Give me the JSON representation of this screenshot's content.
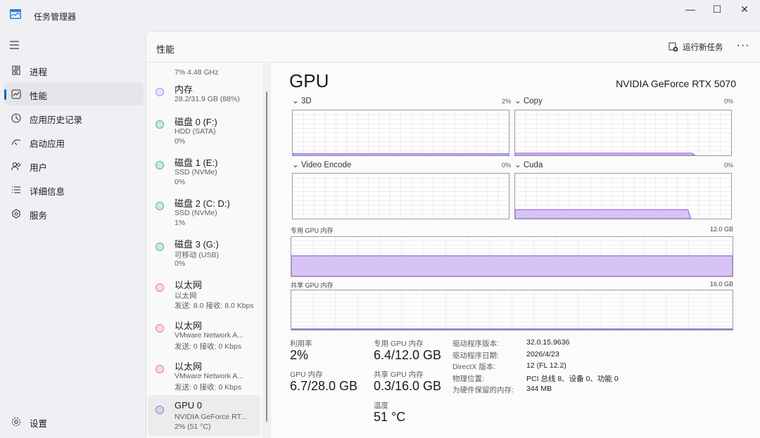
{
  "window": {
    "title": "任务管理器",
    "minimize": "—",
    "maximize": "☐",
    "close": "✕"
  },
  "nav": {
    "items": [
      {
        "label": "进程",
        "icon": "processes-icon"
      },
      {
        "label": "性能",
        "icon": "performance-icon",
        "active": true
      },
      {
        "label": "应用历史记录",
        "icon": "app-history-icon"
      },
      {
        "label": "启动应用",
        "icon": "startup-apps-icon"
      },
      {
        "label": "用户",
        "icon": "users-icon"
      },
      {
        "label": "详细信息",
        "icon": "details-icon"
      },
      {
        "label": "服务",
        "icon": "services-icon"
      }
    ],
    "settings_label": "设置"
  },
  "header": {
    "title": "性能",
    "run_task": "运行新任务",
    "more": "···"
  },
  "devices": [
    {
      "name": "",
      "line1": "7% 4.48 GHz",
      "line2": "",
      "color": "#4a90d9"
    },
    {
      "name": "内存",
      "line1": "28.2/31.9 GB (88%)",
      "line2": "",
      "color": "#8aa4e6"
    },
    {
      "name": "磁盘 0 (F:)",
      "line1": "HDD (SATA)",
      "line2": "0%",
      "color": "#5fae9a"
    },
    {
      "name": "磁盘 1 (E:)",
      "line1": "SSD (NVMe)",
      "line2": "0%",
      "color": "#5fae9a"
    },
    {
      "name": "磁盘 2 (C: D:)",
      "line1": "SSD (NVMe)",
      "line2": "1%",
      "color": "#5fae9a"
    },
    {
      "name": "磁盘 3 (G:)",
      "line1": "可移动 (USB)",
      "line2": "0%",
      "color": "#5fae9a"
    },
    {
      "name": "以太网",
      "line1": "以太网",
      "line2": "发送: 8.0 接收: 8.0 Kbps",
      "color": "#e07ab8"
    },
    {
      "name": "以太网",
      "line1": "VMware Network A...",
      "line2": "发送: 0 接收: 0 Kbps",
      "color": "#e07ab8"
    },
    {
      "name": "以太网",
      "line1": "VMware Network A...",
      "line2": "发送: 0 接收: 0 Kbps",
      "color": "#e07ab8"
    },
    {
      "name": "GPU 0",
      "line1": "NVIDIA GeForce RT...",
      "line2": "2% (51 °C)",
      "color": "#9a7fc2",
      "active": true
    }
  ],
  "gpu": {
    "title": "GPU",
    "model": "NVIDIA GeForce RTX 5070",
    "engines": [
      {
        "label": "3D",
        "pct": "2%",
        "level": 0.04
      },
      {
        "label": "Copy",
        "pct": "0%",
        "level": 0.05
      },
      {
        "label": "Video Encode",
        "pct": "0%",
        "level": 0
      },
      {
        "label": "Cuda",
        "pct": "0%",
        "level": 0.2
      }
    ],
    "dedicated_label": "专用 GPU 内存",
    "dedicated_max": "12.0 GB",
    "dedicated_level": 0.52,
    "shared_label": "共享 GPU 内存",
    "shared_max": "16.0 GB",
    "shared_level": 0.02,
    "stats": {
      "util_label": "利用率",
      "util_value": "2%",
      "ded_label": "专用 GPU 内存",
      "ded_value": "6.4/12.0 GB",
      "gpumem_label": "GPU 内存",
      "gpumem_value": "6.7/28.0 GB",
      "shared_label": "共享 GPU 内存",
      "shared_value": "0.3/16.0 GB",
      "temp_label": "温度",
      "temp_value": "51 °C"
    },
    "info": [
      {
        "k": "驱动程序版本:",
        "v": "32.0.15.9636"
      },
      {
        "k": "驱动程序日期:",
        "v": "2026/4/23"
      },
      {
        "k": "DirectX 版本:",
        "v": "12 (FL 12.2)"
      },
      {
        "k": "物理位置:",
        "v": "PCI 总线 8、设备 0、功能 0"
      },
      {
        "k": "为硬件保留的内存:",
        "v": "344 MB"
      }
    ]
  },
  "colors": {
    "accent": "#0067c0",
    "graph_line": "#9a67d8",
    "graph_fill": "#d8c4f4"
  }
}
